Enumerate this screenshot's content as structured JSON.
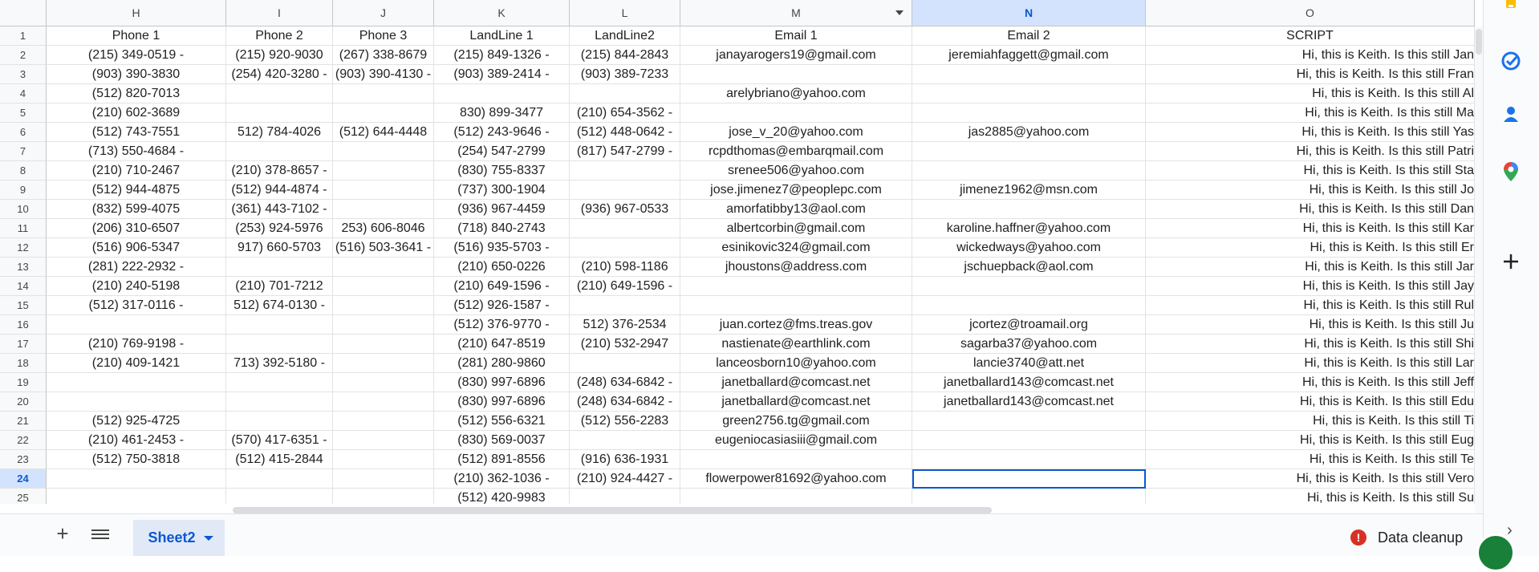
{
  "columns": [
    {
      "letter": "H",
      "header": "Phone 1"
    },
    {
      "letter": "I",
      "header": "Phone 2"
    },
    {
      "letter": "J",
      "header": "Phone 3"
    },
    {
      "letter": "K",
      "header": "LandLine 1"
    },
    {
      "letter": "L",
      "header": "LandLine2"
    },
    {
      "letter": "M",
      "header": "Email 1"
    },
    {
      "letter": "N",
      "header": "Email 2"
    },
    {
      "letter": "O",
      "header": "SCRIPT"
    }
  ],
  "rows": [
    {
      "n": "2",
      "cells": [
        "(215) 349-0519 -",
        "(215) 920-9030",
        "(267) 338-8679",
        "(215) 849-1326 -",
        "(215) 844-2843",
        "janayarogers19@gmail.com",
        "jeremiahfaggett@gmail.com",
        "Hi, this is Keith.  Is this still  Jan"
      ]
    },
    {
      "n": "3",
      "cells": [
        "(903) 390-3830",
        "(254) 420-3280 -",
        "(903) 390-4130 -",
        "(903) 389-2414 -",
        "(903) 389-7233",
        "",
        "",
        "Hi, this is Keith.  Is this still  Fran"
      ]
    },
    {
      "n": "4",
      "cells": [
        "(512) 820-7013",
        "",
        "",
        "",
        "",
        "arelybriano@yahoo.com",
        "",
        "Hi, this is Keith.  Is this still  Al"
      ]
    },
    {
      "n": "5",
      "cells": [
        "(210) 602-3689",
        "",
        "",
        "830) 899-3477",
        "(210) 654-3562 -",
        "",
        "",
        "Hi, this is Keith.  Is this still  Ma"
      ]
    },
    {
      "n": "6",
      "cells": [
        "(512) 743-7551",
        "512) 784-4026",
        "(512) 644-4448",
        "(512) 243-9646 -",
        "(512) 448-0642 -",
        "jose_v_20@yahoo.com",
        "jas2885@yahoo.com",
        "Hi, this is Keith.  Is this still  Yas"
      ]
    },
    {
      "n": "7",
      "cells": [
        "(713) 550-4684 -",
        "",
        "",
        "(254) 547-2799",
        "(817) 547-2799 -",
        "rcpdthomas@embarqmail.com",
        "",
        "Hi, this is Keith.  Is this still  Patri"
      ]
    },
    {
      "n": "8",
      "cells": [
        "(210) 710-2467",
        "(210) 378-8657 -",
        "",
        "(830) 755-8337",
        "",
        "srenee506@yahoo.com",
        "",
        "Hi, this is Keith.  Is this still  Sta"
      ]
    },
    {
      "n": "9",
      "cells": [
        "(512) 944-4875",
        "(512) 944-4874 -",
        "",
        "(737) 300-1904",
        "",
        "jose.jimenez7@peoplepc.com",
        "jimenez1962@msn.com",
        "Hi, this is Keith.  Is this still  Jo"
      ]
    },
    {
      "n": "10",
      "cells": [
        "(832) 599-4075",
        "(361) 443-7102 -",
        "",
        "(936) 967-4459",
        "(936) 967-0533",
        "amorfatibby13@aol.com",
        "",
        "Hi, this is Keith.  Is this still  Dan"
      ]
    },
    {
      "n": "11",
      "cells": [
        "(206) 310-6507",
        "(253) 924-5976",
        "253) 606-8046",
        "(718) 840-2743",
        "",
        "albertcorbin@gmail.com",
        "karoline.haffner@yahoo.com",
        "Hi, this is Keith.  Is this still  Kar"
      ]
    },
    {
      "n": "12",
      "cells": [
        "(516) 906-5347",
        "917) 660-5703",
        "(516) 503-3641 -",
        "(516) 935-5703 -",
        "",
        "esinikovic324@gmail.com",
        "wickedways@yahoo.com",
        "Hi, this is Keith.  Is this still  Er"
      ]
    },
    {
      "n": "13",
      "cells": [
        "(281) 222-2932 -",
        "",
        "",
        "(210) 650-0226",
        "(210) 598-1186",
        "jhoustons@address.com",
        "jschuepback@aol.com",
        "Hi, this is Keith.  Is this still  Jar"
      ]
    },
    {
      "n": "14",
      "cells": [
        "(210) 240-5198",
        "(210) 701-7212",
        "",
        "(210) 649-1596 -",
        "(210) 649-1596 -",
        "",
        "",
        "Hi, this is Keith.  Is this still  Jay"
      ]
    },
    {
      "n": "15",
      "cells": [
        "(512) 317-0116 -",
        "512) 674-0130 -",
        "",
        "(512) 926-1587 -",
        "",
        "",
        "",
        "Hi, this is Keith.  Is this still  Rul"
      ]
    },
    {
      "n": "16",
      "cells": [
        "",
        "",
        "",
        "(512) 376-9770 -",
        "512) 376-2534",
        "juan.cortez@fms.treas.gov",
        "jcortez@troamail.org",
        "Hi, this is Keith.  Is this still  Ju"
      ]
    },
    {
      "n": "17",
      "cells": [
        "(210) 769-9198 -",
        "",
        "",
        "(210) 647-8519",
        "(210) 532-2947",
        "nastienate@earthlink.com",
        "sagarba37@yahoo.com",
        "Hi, this is Keith.  Is this still  Shi"
      ]
    },
    {
      "n": "18",
      "cells": [
        "(210) 409-1421",
        "713) 392-5180 -",
        "",
        "(281) 280-9860",
        "",
        "lanceosborn10@yahoo.com",
        "lancie3740@att.net",
        "Hi, this is Keith.  Is this still  Lar"
      ]
    },
    {
      "n": "19",
      "cells": [
        "",
        "",
        "",
        "(830) 997-6896",
        "(248) 634-6842 -",
        "janetballard@comcast.net",
        "janetballard143@comcast.net",
        "Hi, this is Keith.  Is this still  Jeff"
      ]
    },
    {
      "n": "20",
      "cells": [
        "",
        "",
        "",
        "(830) 997-6896",
        "(248) 634-6842 -",
        "janetballard@comcast.net",
        "janetballard143@comcast.net",
        "Hi, this is Keith.  Is this still  Edu"
      ]
    },
    {
      "n": "21",
      "cells": [
        "(512) 925-4725",
        "",
        "",
        "(512) 556-6321",
        "(512) 556-2283",
        "green2756.tg@gmail.com",
        "",
        "Hi, this is Keith.  Is this still  Ti"
      ]
    },
    {
      "n": "22",
      "cells": [
        "(210) 461-2453 -",
        "(570) 417-6351 -",
        "",
        "(830) 569-0037",
        "",
        "eugeniocasiasiii@gmail.com",
        "",
        "Hi, this is Keith.  Is this still  Eug"
      ]
    },
    {
      "n": "23",
      "cells": [
        "(512) 750-3818",
        "(512) 415-2844",
        "",
        "(512) 891-8556",
        "(916) 636-1931",
        "",
        "",
        "Hi, this is Keith.  Is this still  Te"
      ]
    },
    {
      "n": "24",
      "cells": [
        "",
        "",
        "",
        "(210) 362-1036 -",
        "(210) 924-4427 -",
        "flowerpower81692@yahoo.com",
        "",
        "Hi, this is Keith.  Is this still  Vero"
      ]
    },
    {
      "n": "25",
      "cells": [
        "",
        "",
        "",
        "(512) 420-9983",
        "",
        "",
        "",
        "Hi, this is Keith.  Is this still  Su"
      ]
    }
  ],
  "active_column": "N",
  "active_row": "24",
  "sheet_tab": "Sheet2",
  "data_cleanup_label": "Data cleanup",
  "add_sheet_symbol": "+",
  "chevron_symbol": "›",
  "warning_symbol": "!",
  "side_icons": [
    "keep-icon",
    "tasks-icon",
    "contacts-icon",
    "maps-icon",
    "add-addon-icon"
  ],
  "colors": {
    "accent": "#0b57d0",
    "header_bg": "#f8f9fa",
    "active_header_bg": "#d3e3fd",
    "warning": "#d93025"
  }
}
